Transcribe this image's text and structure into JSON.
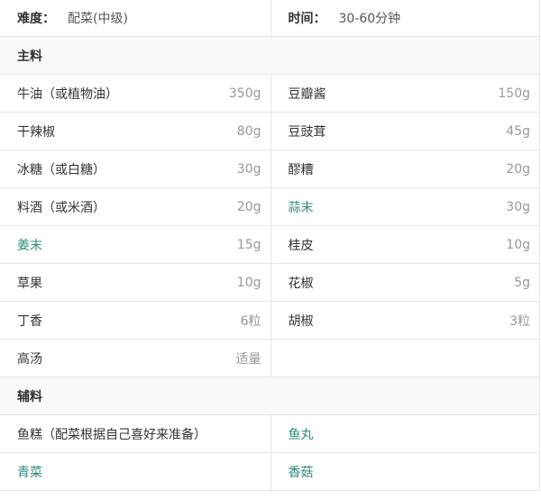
{
  "info": {
    "difficulty_label": "难度：",
    "difficulty_value": "配菜(中级)",
    "time_label": "时间：",
    "time_value": "30-60分钟"
  },
  "main_section": {
    "title": "主料",
    "rows": [
      [
        {
          "name": "牛油（或植物油）",
          "amount": "350g"
        },
        {
          "name": "豆瓣酱",
          "amount": "150g"
        }
      ],
      [
        {
          "name": "干辣椒",
          "amount": "80g"
        },
        {
          "name": "豆豉茸",
          "amount": "45g"
        }
      ],
      [
        {
          "name": "冰糖（或白糖）",
          "amount": "30g"
        },
        {
          "name": "醪糟",
          "amount": "20g"
        }
      ],
      [
        {
          "name": "料酒（或米酒）",
          "amount": "20g"
        },
        {
          "name": "蒜末",
          "amount": "30g"
        }
      ],
      [
        {
          "name": "姜末",
          "amount": "15g"
        },
        {
          "name": "桂皮",
          "amount": "10g"
        }
      ],
      [
        {
          "name": "草果",
          "amount": "10g"
        },
        {
          "name": "花椒",
          "amount": "5g"
        }
      ],
      [
        {
          "name": "丁香",
          "amount": "6粒"
        },
        {
          "name": "胡椒",
          "amount": "3粒"
        }
      ],
      [
        {
          "name": "高汤",
          "amount": "适量"
        }
      ]
    ]
  },
  "side_section": {
    "title": "辅料",
    "rows": [
      [
        {
          "name": "鱼糕（配菜根据自己喜好来准备）"
        },
        {
          "name": "鱼丸"
        }
      ],
      [
        {
          "name": "青菜"
        },
        {
          "name": "香菇"
        }
      ]
    ]
  },
  "colors": {
    "link": "#2e8b7c",
    "amount": "#999999",
    "border": "#e6e6e6",
    "section_bg": "#f9f9f9"
  }
}
